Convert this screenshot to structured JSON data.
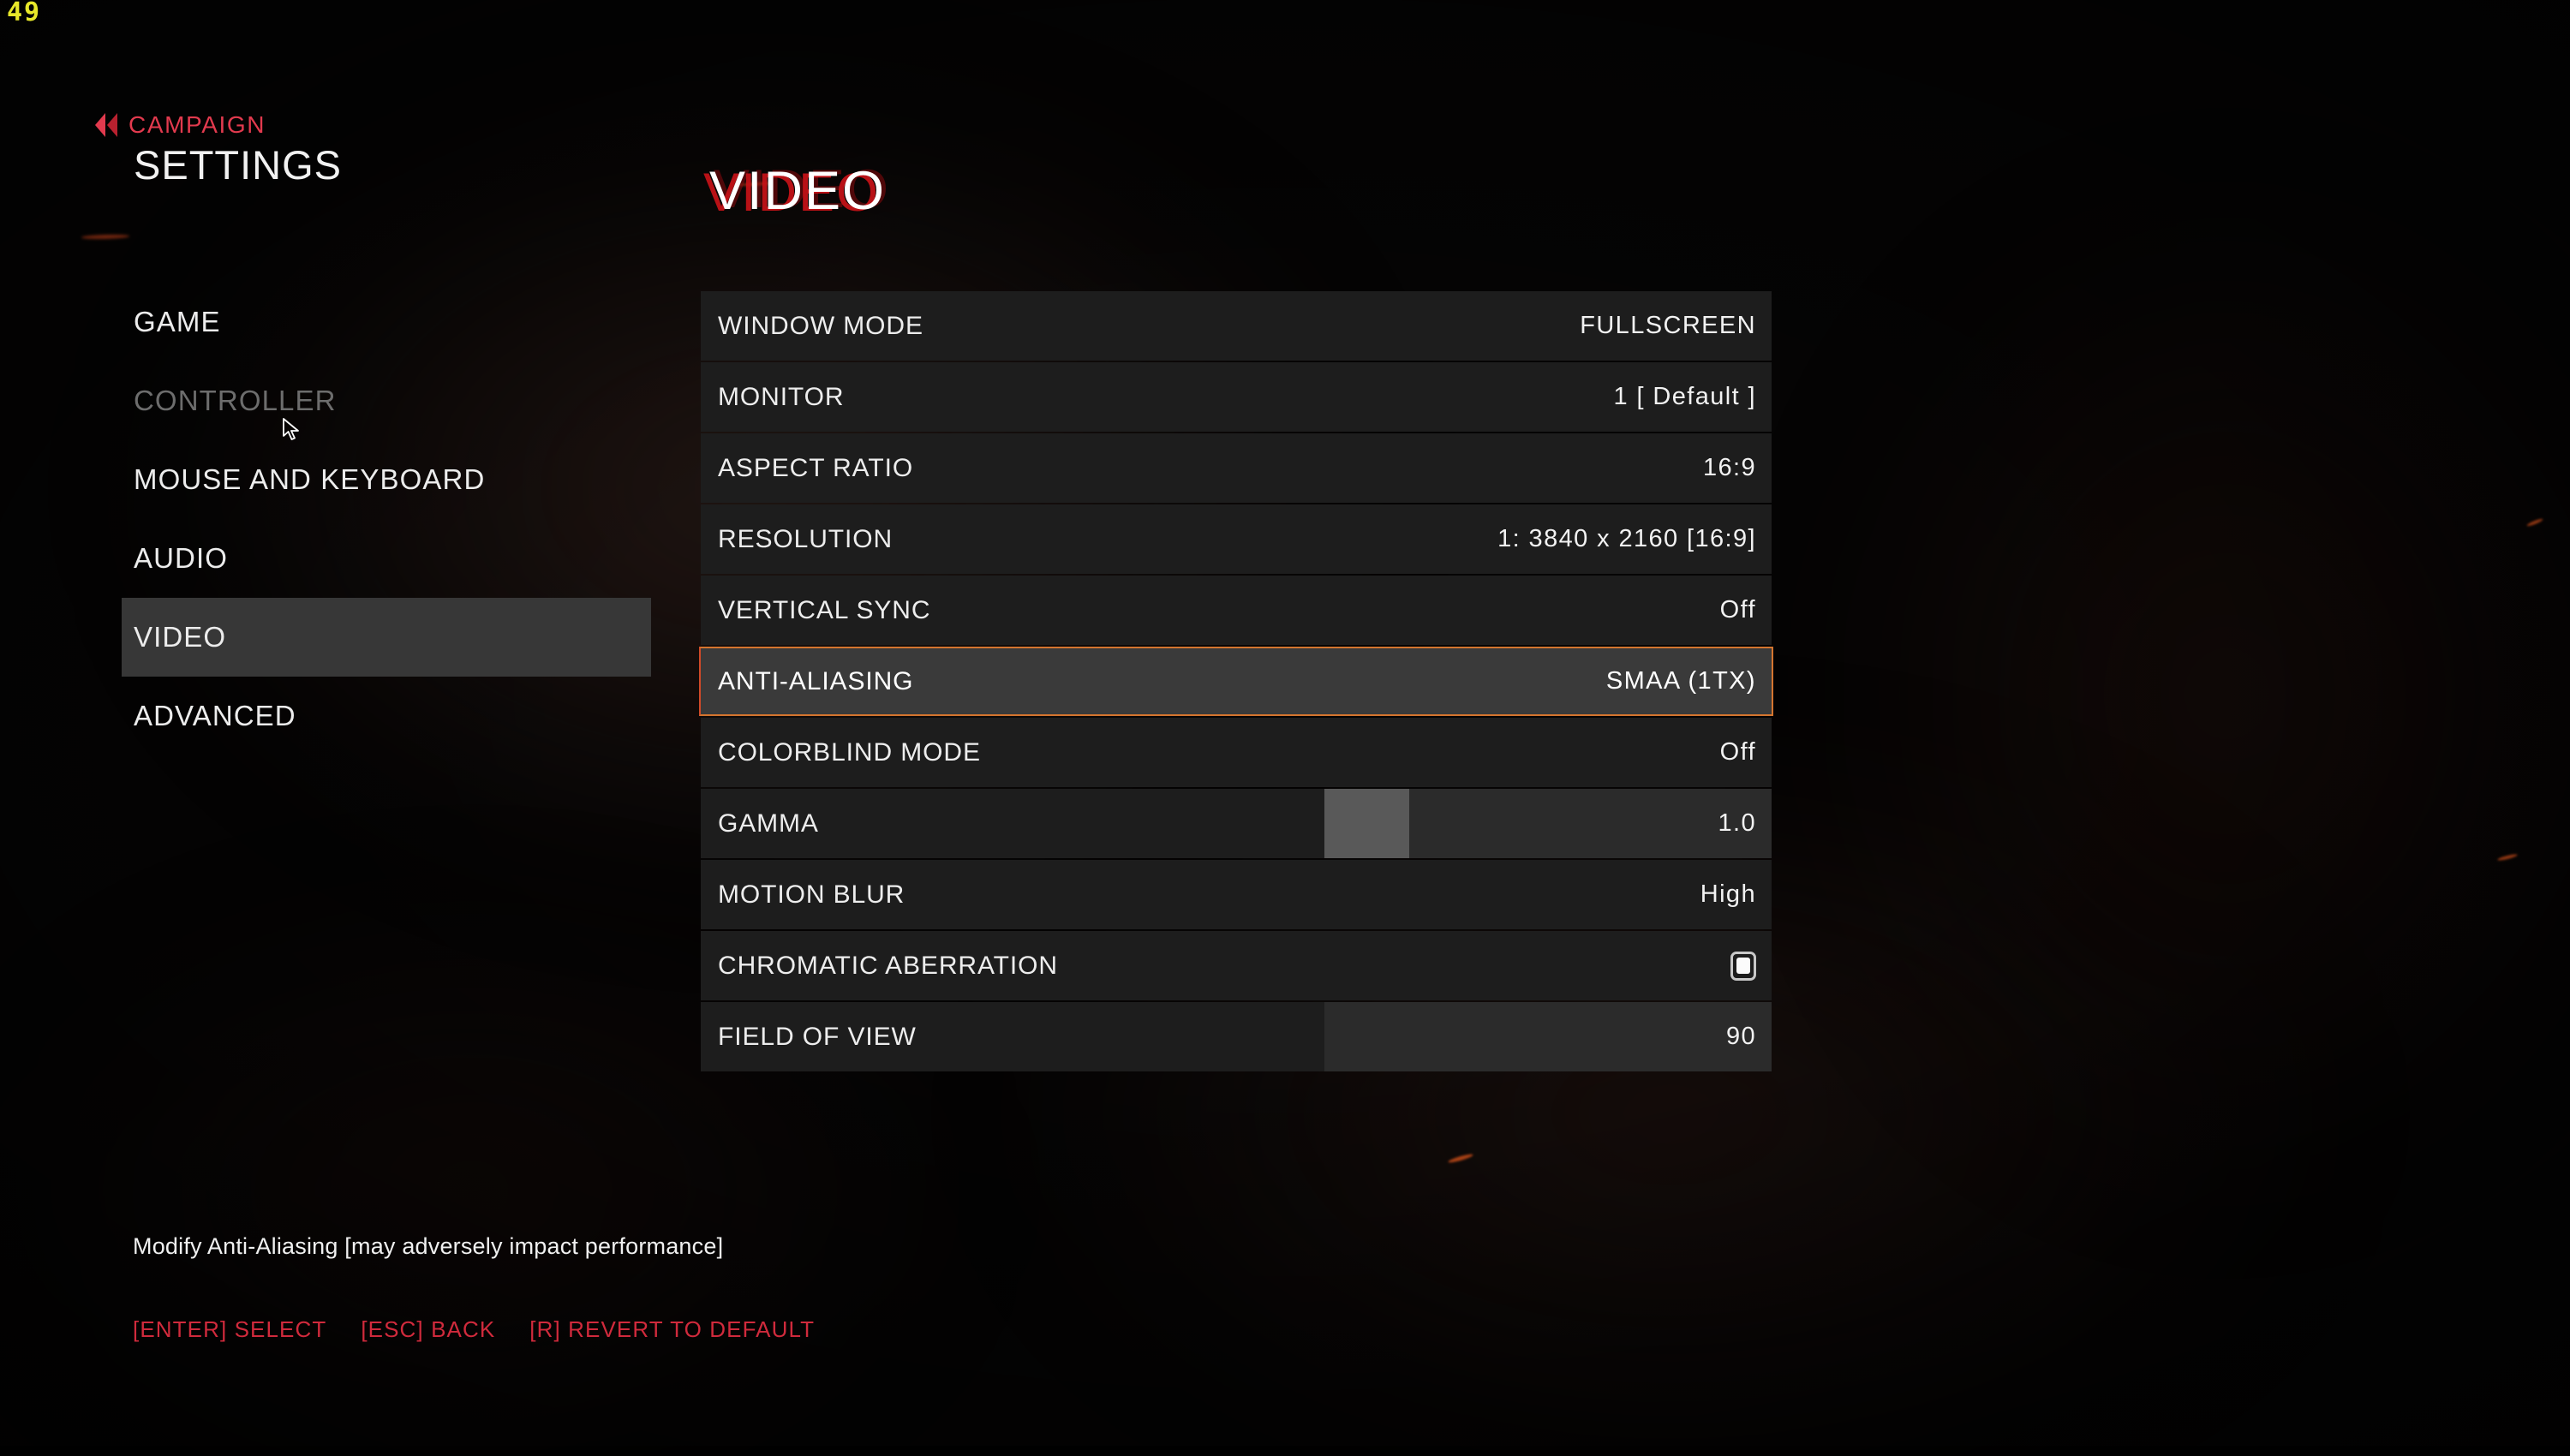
{
  "hud": {
    "fps": "49"
  },
  "header": {
    "back_icon": "double-chevron-left-icon",
    "back_label": "CAMPAIGN",
    "title": "SETTINGS"
  },
  "sidebar": {
    "items": [
      {
        "label": "GAME",
        "state": "normal"
      },
      {
        "label": "CONTROLLER",
        "state": "disabled"
      },
      {
        "label": "MOUSE AND KEYBOARD",
        "state": "normal"
      },
      {
        "label": "AUDIO",
        "state": "normal"
      },
      {
        "label": "VIDEO",
        "state": "selected"
      },
      {
        "label": "ADVANCED",
        "state": "normal"
      }
    ]
  },
  "main": {
    "title": "VIDEO",
    "rows": [
      {
        "label": "WINDOW MODE",
        "value": "FULLSCREEN",
        "type": "option"
      },
      {
        "label": "MONITOR",
        "value": "1 [ Default ]",
        "type": "option"
      },
      {
        "label": "ASPECT RATIO",
        "value": "16:9",
        "type": "option"
      },
      {
        "label": "RESOLUTION",
        "value": "1: 3840 x 2160 [16:9]",
        "type": "option"
      },
      {
        "label": "VERTICAL SYNC",
        "value": "Off",
        "type": "option"
      },
      {
        "label": "ANTI-ALIASING",
        "value": "SMAA (1TX)",
        "type": "option",
        "selected": true
      },
      {
        "label": "COLORBLIND MODE",
        "value": "Off",
        "type": "option"
      },
      {
        "label": "GAMMA",
        "value": "1.0",
        "type": "slider",
        "fill_percent": 19
      },
      {
        "label": "MOTION BLUR",
        "value": "High",
        "type": "option"
      },
      {
        "label": "CHROMATIC ABERRATION",
        "value": "",
        "type": "checkbox",
        "checked": true,
        "icon": "checkbox-checked-icon"
      },
      {
        "label": "FIELD OF VIEW",
        "value": "90",
        "type": "slider",
        "fill_percent": 0
      }
    ]
  },
  "footer": {
    "description": "Modify Anti-Aliasing [may adversely impact performance]",
    "key_hints": [
      {
        "label": "[ENTER] SELECT"
      },
      {
        "label": "[ESC] BACK"
      },
      {
        "label": "[R] REVERT TO DEFAULT"
      }
    ]
  },
  "colors": {
    "accent_red": "#e23a4e",
    "highlight_border": "#d4752f",
    "selected_row_bg": "#3a3a3a",
    "row_bg": "#1d1d1d",
    "fps_yellow": "#e8e82a"
  }
}
